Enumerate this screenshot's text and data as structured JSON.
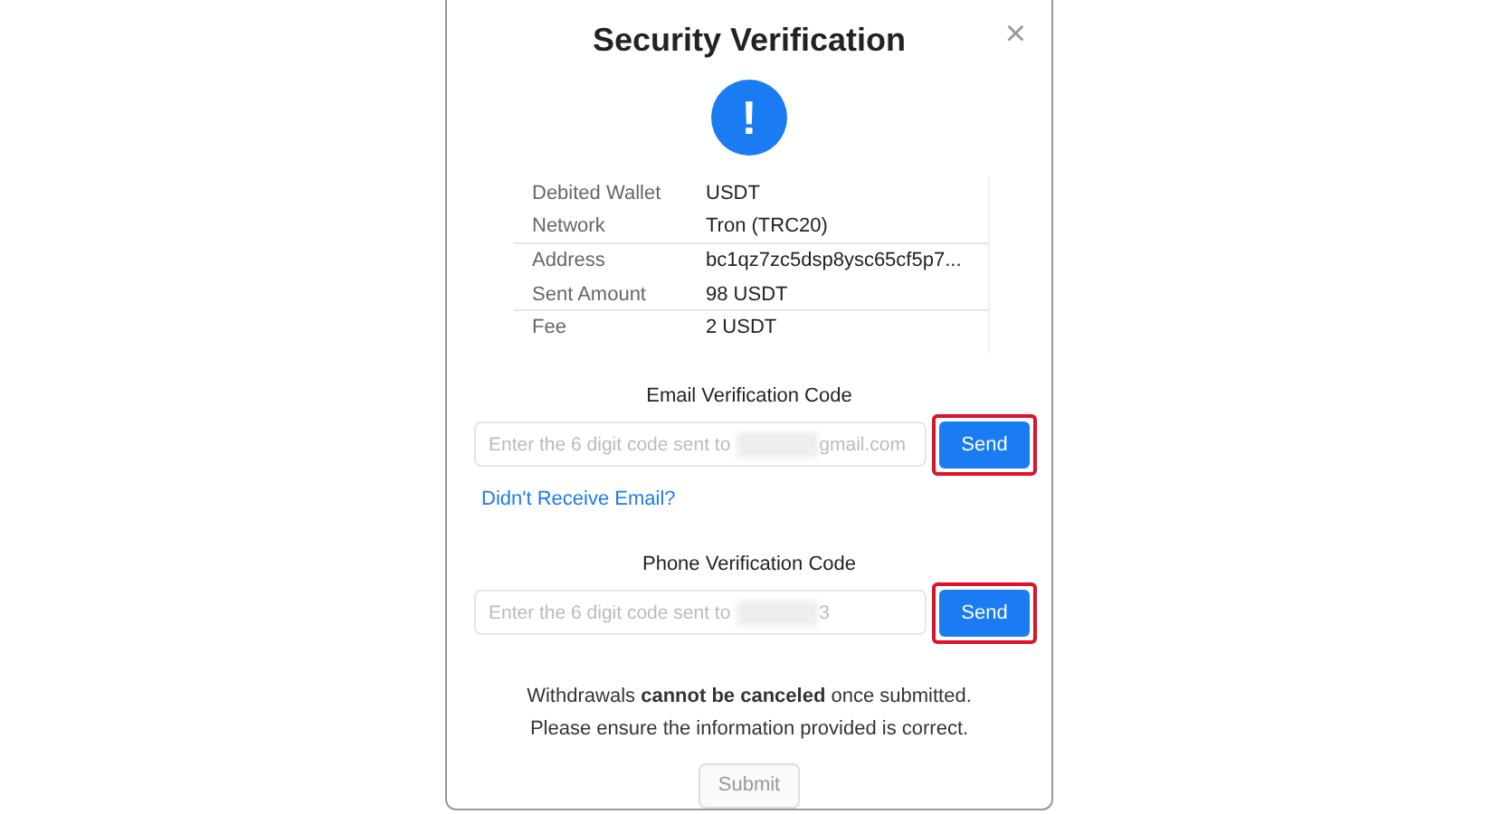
{
  "dialog": {
    "title": "Security Verification",
    "close": "×",
    "icon": "!"
  },
  "details": [
    {
      "label": "Debited Wallet",
      "value": "USDT",
      "divider": false
    },
    {
      "label": "Network",
      "value": "Tron (TRC20)",
      "divider": true
    },
    {
      "label": "Address",
      "value": "bc1qz7zc5dsp8ysc65cf5p7...",
      "divider": false
    },
    {
      "label": "Sent Amount",
      "value": "98 USDT",
      "divider": true
    },
    {
      "label": "Fee",
      "value": "2 USDT",
      "divider": false
    }
  ],
  "codes": [
    {
      "label": "Email Verification Code",
      "placeholder": "Enter the 6 digit code sent to",
      "placeholder_end": "gmail.com",
      "button": "Send",
      "highlighted": true,
      "link": "Didn't Receive Email?"
    },
    {
      "label": "Phone Verification Code",
      "placeholder": "Enter the 6 digit code sent to",
      "placeholder_end": "3",
      "button": "Send",
      "highlighted": true
    }
  ],
  "notice": [
    "Withdrawals **cannot be canceled** once submitted.",
    "Please ensure the information provided is correct."
  ],
  "submit": {
    "label": "Submit",
    "disabled": true
  }
}
